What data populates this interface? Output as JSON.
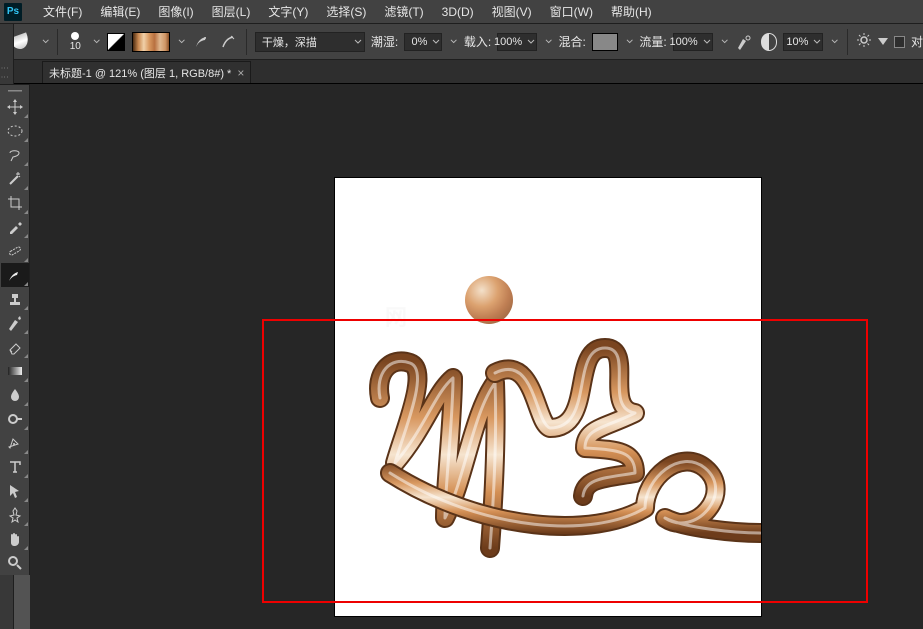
{
  "app": {
    "logo_text": "Ps"
  },
  "menu": {
    "file": "文件(F)",
    "edit": "编辑(E)",
    "image": "图像(I)",
    "layer": "图层(L)",
    "type": "文字(Y)",
    "select": "选择(S)",
    "filter": "滤镜(T)",
    "threeD": "3D(D)",
    "view": "视图(V)",
    "window": "窗口(W)",
    "help": "帮助(H)"
  },
  "opt": {
    "brush_size": "10",
    "preset": "干燥，深描",
    "wet_label": "潮湿:",
    "wet_value": "0%",
    "load_label": "载入:",
    "load_value": "100%",
    "mix_label": "混合:",
    "flow_label": "流量:",
    "flow_value": "100%",
    "opacity_value": "10%",
    "align_label": "对"
  },
  "tab": {
    "title": "未标题-1 @ 121% (图层 1, RGB/8#) *"
  },
  "tools": {
    "move": "move-tool",
    "rect_marquee": "rectangular-marquee-tool",
    "lasso": "lasso-tool",
    "quick_select": "quick-selection-tool",
    "crop": "crop-tool",
    "eyedropper": "eyedropper-tool",
    "patch": "spot-healing-tool",
    "mixer_brush": "mixer-brush-tool",
    "stamp": "clone-stamp-tool",
    "history": "history-brush-tool",
    "eraser": "eraser-tool",
    "gradient": "gradient-tool",
    "blur": "blur-tool",
    "dodge": "dodge-tool",
    "pen": "pen-tool",
    "text": "type-tool",
    "path_select": "path-selection-tool",
    "shape": "shape-tool",
    "hand": "hand-tool",
    "zoom": "zoom-tool"
  }
}
